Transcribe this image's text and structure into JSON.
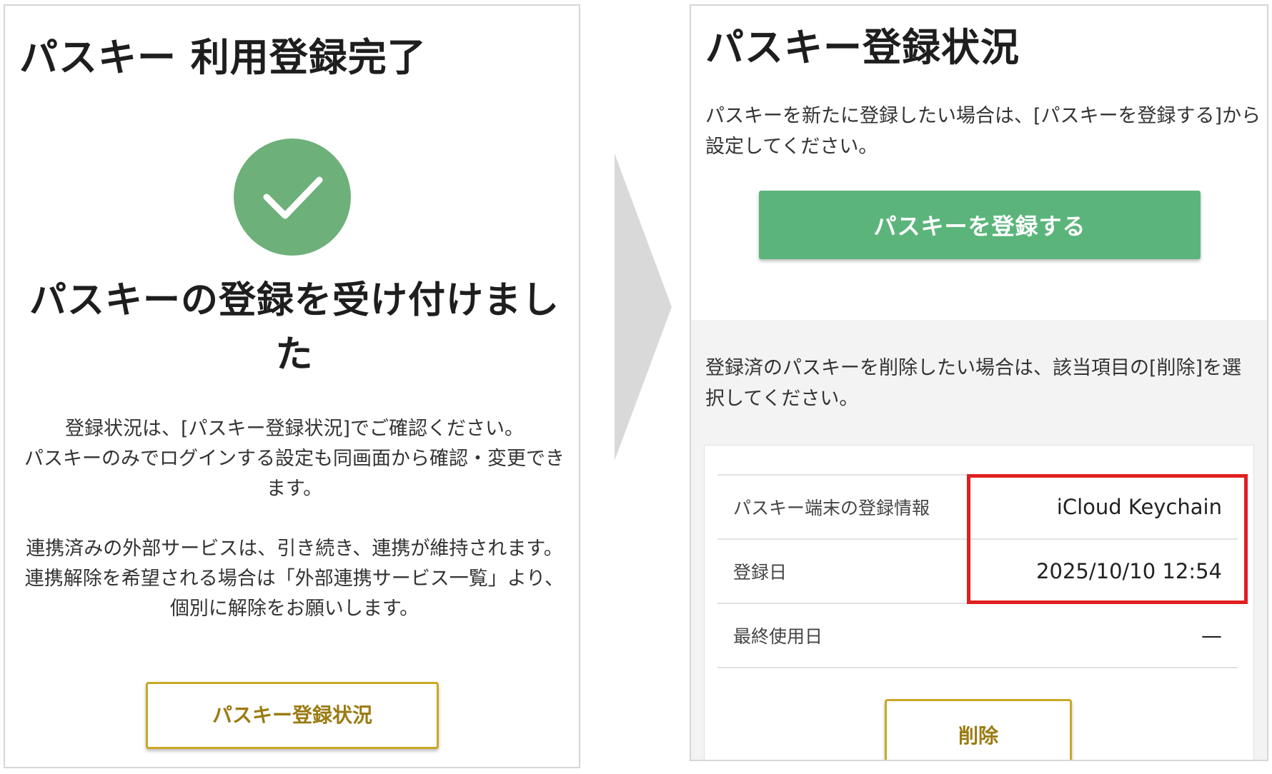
{
  "left_panel": {
    "title": "パスキー 利用登録完了",
    "success_icon": "check-circle-icon",
    "heading": "パスキーの登録を受け付けました",
    "body": {
      "para1_line1": "登録状況は、[パスキー登録状況]でご確認ください。",
      "para1_line2": "パスキーのみでログインする設定も同画面から確認・変更できます。",
      "para2_line1": "連携済みの外部サービスは、引き続き、連携が維持されます。",
      "para2_line2": "連携解除を希望される場合は「外部連携サービス一覧」より、個別に解除をお願いします。"
    },
    "status_button_label": "パスキー登録状況"
  },
  "arrow_icon": "chevron-right-arrow-icon",
  "right_panel": {
    "title": "パスキー登録状況",
    "description": "パスキーを新たに登録したい場合は、[パスキーを登録する]から設定してください。",
    "register_button_label": "パスキーを登録する",
    "delete_description": "登録済のパスキーを削除したい場合は、該当項目の[削除]を選択してください。",
    "rows": [
      {
        "label": "パスキー端末の登録情報",
        "value": "iCloud Keychain"
      },
      {
        "label": "登録日",
        "value": "2025/10/10 12:54"
      },
      {
        "label": "最終使用日",
        "value": "—"
      }
    ],
    "delete_button_label": "削除"
  },
  "colors": {
    "success_green": "#6db07a",
    "button_green": "#5bb57b",
    "gold_border": "#c9a824",
    "gold_text": "#9b7b12",
    "highlight_red": "#e02020",
    "section_gray": "#f3f3f3"
  }
}
